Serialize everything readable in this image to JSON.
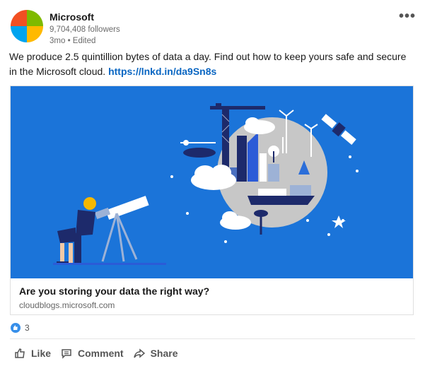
{
  "post": {
    "org_name": "Microsoft",
    "followers": "9,704,408 followers",
    "meta": "3mo • Edited",
    "text": "We produce 2.5 quintillion bytes of data a day. Find out how to keep yours safe and secure in the Microsoft cloud.",
    "link": "https://lnkd.in/da9Sn8s",
    "menu_label": "•••"
  },
  "card": {
    "title": "Are you storing your data the right way?",
    "domain": "cloudblogs.microsoft.com"
  },
  "reactions": {
    "count": "3"
  },
  "actions": {
    "like": "Like",
    "comment": "Comment",
    "share": "Share"
  },
  "colors": {
    "logo": [
      "#f25022",
      "#7fba00",
      "#00a4ef",
      "#ffb900"
    ],
    "link": "#0a66c2",
    "card_bg": "#1b74d9"
  }
}
